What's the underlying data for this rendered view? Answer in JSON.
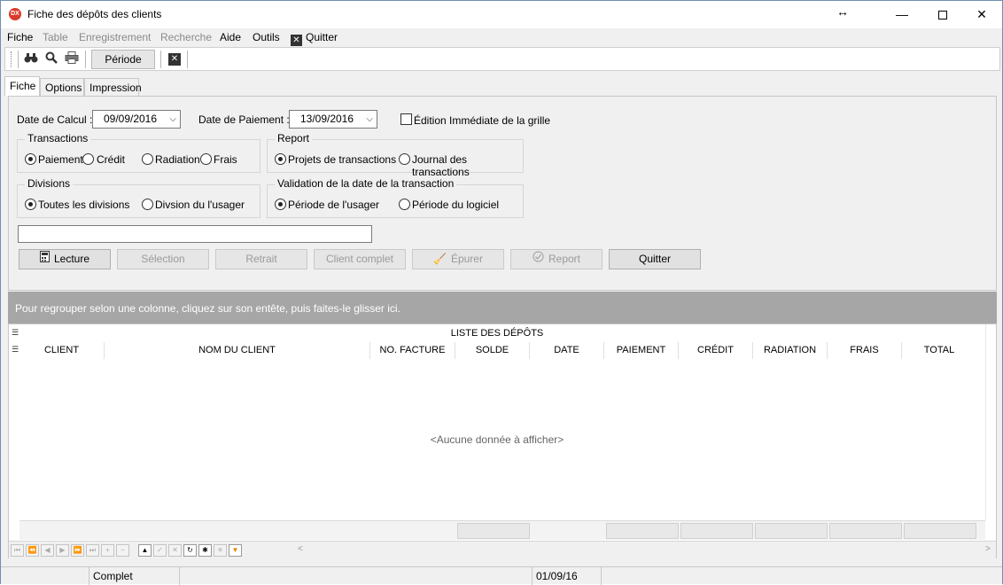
{
  "window": {
    "title": "Fiche des dépôts des clients",
    "app_icon": "DX"
  },
  "menu": {
    "items": [
      {
        "label": "Fiche",
        "enabled": true
      },
      {
        "label": "Table",
        "enabled": false
      },
      {
        "label": "Enregistrement",
        "enabled": false
      },
      {
        "label": "Recherche",
        "enabled": false
      },
      {
        "label": "Aide",
        "enabled": true
      },
      {
        "label": "Outils",
        "enabled": true
      }
    ],
    "quit_label": "Quitter"
  },
  "toolbar": {
    "periode_label": "Période",
    "icons": [
      "binoculars-icon",
      "search-icon",
      "print-icon",
      "close-icon"
    ]
  },
  "tabs": [
    {
      "label": "Fiche",
      "active": true
    },
    {
      "label": "Options",
      "active": false
    },
    {
      "label": "Impression",
      "active": false
    }
  ],
  "form": {
    "date_calcul_label": "Date de Calcul :",
    "date_calcul_value": "09/09/2016",
    "date_paiement_label": "Date de Paiement :",
    "date_paiement_value": "13/09/2016",
    "edition_label": "Édition Immédiate de la grille",
    "edition_checked": false,
    "transactions": {
      "title": "Transactions",
      "options": [
        "Paiement",
        "Crédit",
        "Radiation",
        "Frais"
      ],
      "selected": "Paiement"
    },
    "report": {
      "title": "Report",
      "options": [
        "Projets de transactions",
        "Journal des transactions"
      ],
      "selected": "Projets de transactions"
    },
    "divisions": {
      "title": "Divisions",
      "options": [
        "Toutes les divisions",
        "Divsion du l'usager"
      ],
      "selected": "Toutes les divisions"
    },
    "validation": {
      "title": "Validation de la date de la transaction",
      "options": [
        "Période de l'usager",
        "Période du logiciel"
      ],
      "selected": "Période de l'usager"
    },
    "text_value": ""
  },
  "buttons": [
    {
      "label": "Lecture",
      "enabled": true,
      "icon": "calculator-icon"
    },
    {
      "label": "Sélection",
      "enabled": false
    },
    {
      "label": "Retrait",
      "enabled": false
    },
    {
      "label": "Client complet",
      "enabled": false
    },
    {
      "label": "Épurer",
      "enabled": false,
      "icon": "broom-icon"
    },
    {
      "label": "Report",
      "enabled": false,
      "icon": "check-circle-icon"
    },
    {
      "label": "Quitter",
      "enabled": true
    }
  ],
  "grid": {
    "group_hint": "Pour regrouper selon une colonne, cliquez sur son entête, puis faites-le glisser ici.",
    "title": "LISTE DES DÉPÔTS",
    "columns": [
      "CLIENT",
      "NOM DU CLIENT",
      "NO. FACTURE",
      "SOLDE",
      "DATE",
      "PAIEMENT",
      "CRÉDIT",
      "RADIATION",
      "FRAIS",
      "TOTAL"
    ],
    "empty_text": "<Aucune donnée à afficher>"
  },
  "status": {
    "state": "Complet",
    "date": "01/09/16"
  }
}
